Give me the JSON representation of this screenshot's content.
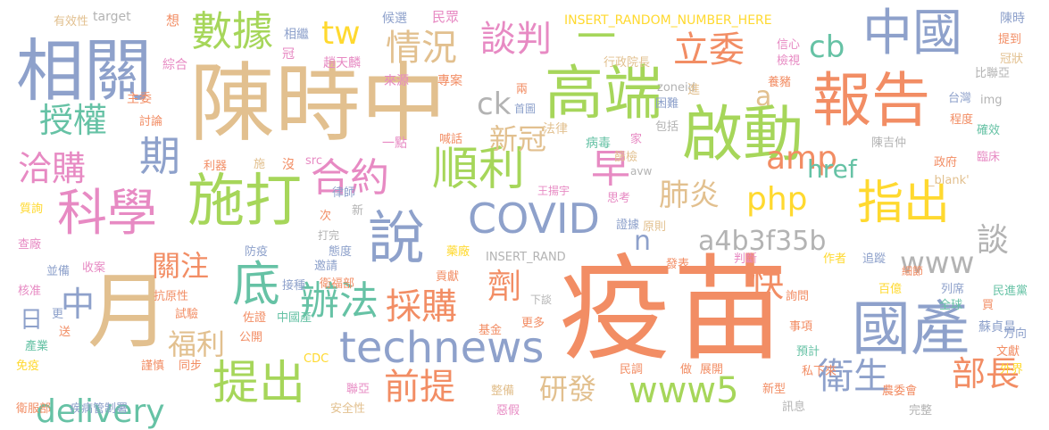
{
  "palette": {
    "orange": "#f28d64",
    "tan": "#e2c08f",
    "green": "#a6d65a",
    "blue": "#8ea1cb",
    "pink": "#e78ac3",
    "teal": "#66c2a5",
    "yellow": "#ffd92f",
    "grey": "#b3b3b3"
  },
  "words": [
    {
      "text": "疫苗",
      "color": "orange"
    },
    {
      "text": "陳時中",
      "color": "tan"
    },
    {
      "text": "相關",
      "color": "blue"
    },
    {
      "text": "啟動",
      "color": "green"
    },
    {
      "text": "高端",
      "color": "green"
    },
    {
      "text": "報告",
      "color": "orange"
    },
    {
      "text": "中國",
      "color": "blue"
    },
    {
      "text": "國產",
      "color": "blue"
    },
    {
      "text": "施打",
      "color": "green"
    },
    {
      "text": "說",
      "color": "blue"
    },
    {
      "text": "月",
      "color": "tan"
    },
    {
      "text": "科學",
      "color": "pink"
    },
    {
      "text": "指出",
      "color": "yellow"
    },
    {
      "text": "提出",
      "color": "green"
    },
    {
      "text": "technews",
      "color": "blue"
    },
    {
      "text": "COVID",
      "color": "blue"
    },
    {
      "text": "數據",
      "color": "green"
    },
    {
      "text": "順利",
      "color": "green"
    },
    {
      "text": "底",
      "color": "teal"
    },
    {
      "text": "期",
      "color": "blue"
    },
    {
      "text": "delivery",
      "color": "teal"
    },
    {
      "text": "www5",
      "color": "green"
    },
    {
      "text": "前提",
      "color": "orange"
    },
    {
      "text": "衛生",
      "color": "blue"
    },
    {
      "text": "部長",
      "color": "orange"
    },
    {
      "text": "採購",
      "color": "orange"
    },
    {
      "text": "辦法",
      "color": "teal"
    },
    {
      "text": "合約",
      "color": "pink"
    },
    {
      "text": "談判",
      "color": "pink"
    },
    {
      "text": "情況",
      "color": "tan"
    },
    {
      "text": "立委",
      "color": "orange"
    },
    {
      "text": "授權",
      "color": "teal"
    },
    {
      "text": "洽購",
      "color": "pink"
    },
    {
      "text": "一",
      "color": "green"
    },
    {
      "text": "早",
      "color": "pink"
    },
    {
      "text": "amp",
      "color": "orange"
    },
    {
      "text": "php",
      "color": "yellow"
    },
    {
      "text": "cb",
      "color": "teal"
    },
    {
      "text": "tw",
      "color": "yellow"
    },
    {
      "text": "a4b3f35b",
      "color": "grey"
    },
    {
      "text": "www",
      "color": "grey"
    },
    {
      "text": "談",
      "color": "grey"
    },
    {
      "text": "快",
      "color": "orange"
    },
    {
      "text": "劑",
      "color": "orange"
    },
    {
      "text": "中",
      "color": "blue"
    },
    {
      "text": "肺炎",
      "color": "tan"
    },
    {
      "text": "研發",
      "color": "tan"
    },
    {
      "text": "關注",
      "color": "orange"
    },
    {
      "text": "福利",
      "color": "tan"
    },
    {
      "text": "新冠",
      "color": "tan"
    },
    {
      "text": "ck",
      "color": "grey"
    },
    {
      "text": "href",
      "color": "teal"
    },
    {
      "text": "n",
      "color": "blue"
    },
    {
      "text": "a",
      "color": "tan"
    },
    {
      "text": "日",
      "color": "blue"
    },
    {
      "text": "有效性",
      "color": "tan"
    },
    {
      "text": "target",
      "color": "grey"
    },
    {
      "text": "想",
      "color": "orange"
    },
    {
      "text": "候選",
      "color": "blue"
    },
    {
      "text": "民眾",
      "color": "pink"
    },
    {
      "text": "INSERT_RANDOM_NUMBER_HERE",
      "color": "yellow"
    },
    {
      "text": "陳時",
      "color": "blue"
    },
    {
      "text": "相繼",
      "color": "blue"
    },
    {
      "text": "趙天麟",
      "color": "pink"
    },
    {
      "text": "信心",
      "color": "pink"
    },
    {
      "text": "提到",
      "color": "orange"
    },
    {
      "text": "行政院長",
      "color": "tan"
    },
    {
      "text": "檢視",
      "color": "pink"
    },
    {
      "text": "冠狀",
      "color": "tan"
    },
    {
      "text": "綜合",
      "color": "pink"
    },
    {
      "text": "冠",
      "color": "pink"
    },
    {
      "text": "來源",
      "color": "pink"
    },
    {
      "text": "專案",
      "color": "orange"
    },
    {
      "text": "兩",
      "color": "orange"
    },
    {
      "text": "zoneid",
      "color": "grey"
    },
    {
      "text": "比聯亞",
      "color": "grey"
    },
    {
      "text": "主委",
      "color": "orange"
    },
    {
      "text": "首圖",
      "color": "blue"
    },
    {
      "text": "困難",
      "color": "blue"
    },
    {
      "text": "進",
      "color": "tan"
    },
    {
      "text": "養豬",
      "color": "orange"
    },
    {
      "text": "台灣",
      "color": "blue"
    },
    {
      "text": "img",
      "color": "grey"
    },
    {
      "text": "討論",
      "color": "orange"
    },
    {
      "text": "法律",
      "color": "tan"
    },
    {
      "text": "包括",
      "color": "grey"
    },
    {
      "text": "程度",
      "color": "orange"
    },
    {
      "text": "確效",
      "color": "teal"
    },
    {
      "text": "一點",
      "color": "pink"
    },
    {
      "text": "喊話",
      "color": "orange"
    },
    {
      "text": "病毒",
      "color": "teal"
    },
    {
      "text": "家",
      "color": "pink"
    },
    {
      "text": "陳吉仲",
      "color": "grey"
    },
    {
      "text": "篩檢",
      "color": "tan"
    },
    {
      "text": "政府",
      "color": "orange"
    },
    {
      "text": "臨床",
      "color": "pink"
    },
    {
      "text": "利器",
      "color": "orange"
    },
    {
      "text": "施",
      "color": "tan"
    },
    {
      "text": "沒",
      "color": "orange"
    },
    {
      "text": "src",
      "color": "pink"
    },
    {
      "text": "avw",
      "color": "grey"
    },
    {
      "text": "_blank'",
      "color": "tan"
    },
    {
      "text": "王揚宇",
      "color": "pink"
    },
    {
      "text": "律師",
      "color": "blue"
    },
    {
      "text": "思考",
      "color": "pink"
    },
    {
      "text": "質詢",
      "color": "yellow"
    },
    {
      "text": "次",
      "color": "orange"
    },
    {
      "text": "新",
      "color": "grey"
    },
    {
      "text": "證據",
      "color": "blue"
    },
    {
      "text": "原則",
      "color": "tan"
    },
    {
      "text": "查廠",
      "color": "pink"
    },
    {
      "text": "打完",
      "color": "grey"
    },
    {
      "text": "防疫",
      "color": "blue"
    },
    {
      "text": "藥廠",
      "color": "yellow"
    },
    {
      "text": "INSERT_RAND",
      "color": "grey"
    },
    {
      "text": "發表",
      "color": "orange"
    },
    {
      "text": "判斷",
      "color": "pink"
    },
    {
      "text": "作者",
      "color": "yellow"
    },
    {
      "text": "追蹤",
      "color": "blue"
    },
    {
      "text": "並備",
      "color": "blue"
    },
    {
      "text": "收案",
      "color": "pink"
    },
    {
      "text": "邀請",
      "color": "blue"
    },
    {
      "text": "態度",
      "color": "blue"
    },
    {
      "text": "細節",
      "color": "orange"
    },
    {
      "text": "核准",
      "color": "pink"
    },
    {
      "text": "接種",
      "color": "blue"
    },
    {
      "text": "衛福部",
      "color": "orange"
    },
    {
      "text": "貢獻",
      "color": "orange"
    },
    {
      "text": "百億",
      "color": "yellow"
    },
    {
      "text": "列席",
      "color": "blue"
    },
    {
      "text": "民進黨",
      "color": "teal"
    },
    {
      "text": "抗原性",
      "color": "orange"
    },
    {
      "text": "下談",
      "color": "grey"
    },
    {
      "text": "詢問",
      "color": "orange"
    },
    {
      "text": "全球",
      "color": "teal"
    },
    {
      "text": "買",
      "color": "orange"
    },
    {
      "text": "更",
      "color": "blue"
    },
    {
      "text": "試驗",
      "color": "orange"
    },
    {
      "text": "佐證",
      "color": "orange"
    },
    {
      "text": "中國產",
      "color": "teal"
    },
    {
      "text": "基金",
      "color": "orange"
    },
    {
      "text": "更多",
      "color": "orange"
    },
    {
      "text": "事項",
      "color": "orange"
    },
    {
      "text": "方向",
      "color": "blue"
    },
    {
      "text": "送",
      "color": "orange"
    },
    {
      "text": "公開",
      "color": "orange"
    },
    {
      "text": "蘇貞昌",
      "color": "blue"
    },
    {
      "text": "產業",
      "color": "teal"
    },
    {
      "text": "CDC",
      "color": "yellow"
    },
    {
      "text": "預計",
      "color": "teal"
    },
    {
      "text": "文獻",
      "color": "orange"
    },
    {
      "text": "免疫",
      "color": "yellow"
    },
    {
      "text": "謹慎",
      "color": "orange"
    },
    {
      "text": "同步",
      "color": "orange"
    },
    {
      "text": "民調",
      "color": "orange"
    },
    {
      "text": "做",
      "color": "orange"
    },
    {
      "text": "展開",
      "color": "orange"
    },
    {
      "text": "私下來",
      "color": "orange"
    },
    {
      "text": "外界",
      "color": "yellow"
    },
    {
      "text": "新型",
      "color": "orange"
    },
    {
      "text": "聯亞",
      "color": "pink"
    },
    {
      "text": "整備",
      "color": "tan"
    },
    {
      "text": "衛服部",
      "color": "orange"
    },
    {
      "text": "疾病管制署",
      "color": "blue"
    },
    {
      "text": "安全性",
      "color": "tan"
    },
    {
      "text": "惡假",
      "color": "pink"
    },
    {
      "text": "訊息",
      "color": "grey"
    },
    {
      "text": "農委會",
      "color": "orange"
    },
    {
      "text": "完整",
      "color": "grey"
    }
  ]
}
